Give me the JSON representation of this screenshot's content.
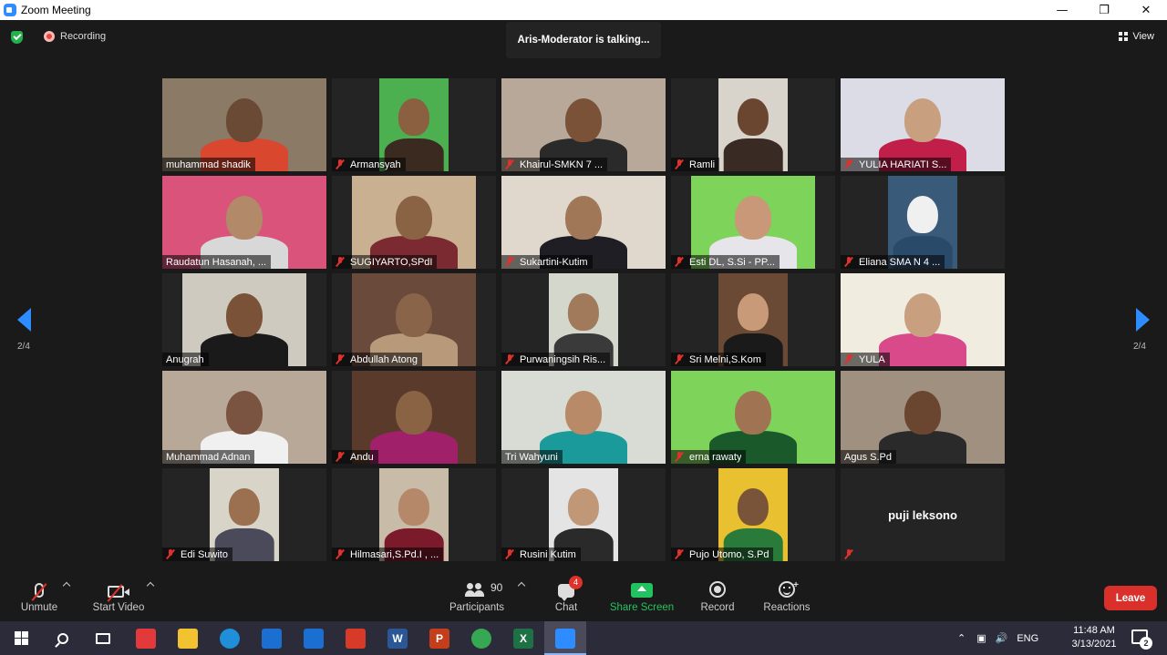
{
  "window": {
    "title": "Zoom Meeting"
  },
  "topbar": {
    "recording_label": "Recording",
    "talking_indicator": "Aris-Moderator is talking...",
    "view_label": "View"
  },
  "navigation": {
    "page_indicator_left": "2/4",
    "page_indicator_right": "2/4"
  },
  "participants": [
    {
      "name": "muhammad shadik",
      "muted": false,
      "video": true,
      "bg": "#8a7a66",
      "face": "#6b4a35",
      "shirt": "#d9472e",
      "vx": 0,
      "vw": 180
    },
    {
      "name": "Armansyah",
      "muted": true,
      "video": true,
      "bg": "#4caf50",
      "face": "#8a6040",
      "shirt": "#3a2a20",
      "vx": 52,
      "vw": 76
    },
    {
      "name": "Khairul-SMKN 7 ...",
      "muted": true,
      "video": true,
      "bg": "#b8a89a",
      "face": "#7a5238",
      "shirt": "#2a2a2a",
      "vx": 0,
      "vw": 180
    },
    {
      "name": "Ramli",
      "muted": true,
      "video": true,
      "bg": "#d8d4cc",
      "face": "#6a4630",
      "shirt": "#3a2a24",
      "vx": 52,
      "vw": 76
    },
    {
      "name": "YULIA HARIATI S...",
      "muted": true,
      "video": true,
      "bg": "#dcdce6",
      "face": "#c8a080",
      "shirt": "#c21e4a",
      "vx": 0,
      "vw": 180
    },
    {
      "name": "Raudatun Hasanah, ...",
      "muted": false,
      "video": true,
      "bg": "#d9537a",
      "face": "#b28a6a",
      "shirt": "#d8d8d8",
      "vx": 0,
      "vw": 180
    },
    {
      "name": "SUGIYARTO,SPdI",
      "muted": true,
      "video": true,
      "bg": "#c8b090",
      "face": "#8a6244",
      "shirt": "#7a2a30",
      "vx": 22,
      "vw": 136
    },
    {
      "name": "Sukartini-Kutim",
      "muted": true,
      "video": true,
      "bg": "#e0d8cc",
      "face": "#a07858",
      "shirt": "#1e1e24",
      "vx": 0,
      "vw": 180
    },
    {
      "name": "Esti DL, S.Si - PP...",
      "muted": true,
      "video": true,
      "bg": "#7ed35a",
      "face": "#c89878",
      "shirt": "#e6e6ea",
      "vx": 22,
      "vw": 136
    },
    {
      "name": "Eliana SMA N 4 ...",
      "muted": true,
      "video": true,
      "bg": "#3a5a7a",
      "face": "#f0f0f0",
      "shirt": "#2a4a6a",
      "vx": 52,
      "vw": 76
    },
    {
      "name": "Anugrah",
      "muted": false,
      "video": true,
      "bg": "#cfcac0",
      "face": "#7a5238",
      "shirt": "#1a1a1a",
      "vx": 22,
      "vw": 136
    },
    {
      "name": "Abdullah Atong",
      "muted": true,
      "video": true,
      "bg": "#6a4a3a",
      "face": "#8a6448",
      "shirt": "#b89a7a",
      "vx": 22,
      "vw": 136
    },
    {
      "name": "Purwaningsih Ris...",
      "muted": true,
      "video": true,
      "bg": "#d4d8cc",
      "face": "#a07a5a",
      "shirt": "#3a3a3a",
      "vx": 52,
      "vw": 76
    },
    {
      "name": "Sri Melni,S.Kom",
      "muted": true,
      "video": true,
      "bg": "#6a4a34",
      "face": "#c89a78",
      "shirt": "#1a1a1a",
      "vx": 52,
      "vw": 76
    },
    {
      "name": "YULA",
      "muted": true,
      "video": true,
      "bg": "#f0ece0",
      "face": "#c8a080",
      "shirt": "#d84a8a",
      "vx": 0,
      "vw": 180
    },
    {
      "name": "Muhammad Adnan",
      "muted": false,
      "video": true,
      "bg": "#b8a898",
      "face": "#7a5440",
      "shirt": "#f0f0f0",
      "vx": 0,
      "vw": 180
    },
    {
      "name": "Andu",
      "muted": true,
      "video": true,
      "bg": "#5a3a2a",
      "face": "#8a6244",
      "shirt": "#a0206a",
      "vx": 22,
      "vw": 136
    },
    {
      "name": "Tri Wahyuni",
      "muted": false,
      "video": true,
      "bg": "#d8dcd4",
      "face": "#b88a68",
      "shirt": "#1a9a9a",
      "vx": 0,
      "vw": 180
    },
    {
      "name": "erna rawaty",
      "muted": true,
      "video": true,
      "bg": "#7ed35a",
      "face": "#a07452",
      "shirt": "#1a5a2a",
      "vx": 0,
      "vw": 180
    },
    {
      "name": "Agus S.Pd",
      "muted": false,
      "video": true,
      "bg": "#a09080",
      "face": "#6a4630",
      "shirt": "#2a2a2a",
      "vx": 0,
      "vw": 180
    },
    {
      "name": "Edi Suwito",
      "muted": true,
      "video": true,
      "bg": "#d8d4c8",
      "face": "#9a7050",
      "shirt": "#4a4a5a",
      "vx": 52,
      "vw": 76
    },
    {
      "name": "Hilmasari,S.Pd.I , ...",
      "muted": true,
      "video": true,
      "bg": "#c8bca8",
      "face": "#b48868",
      "shirt": "#7a1a2a",
      "vx": 52,
      "vw": 76
    },
    {
      "name": "Rusini Kutim",
      "muted": true,
      "video": true,
      "bg": "#e4e4e4",
      "face": "#c09878",
      "shirt": "#2a2a2a",
      "vx": 52,
      "vw": 76
    },
    {
      "name": "Pujo Utomo, S.Pd",
      "muted": true,
      "video": true,
      "bg": "#e8c030",
      "face": "#7a5438",
      "shirt": "#2a7a3a",
      "vx": 52,
      "vw": 76
    },
    {
      "name": "puji leksono",
      "muted": true,
      "video": false,
      "bg": "#242424",
      "face": "",
      "shirt": "",
      "vx": 0,
      "vw": 0
    }
  ],
  "toolbar": {
    "unmute": "Unmute",
    "start_video": "Start Video",
    "participants": "Participants",
    "participant_count": "90",
    "chat": "Chat",
    "chat_badge": "4",
    "share_screen": "Share Screen",
    "record": "Record",
    "reactions": "Reactions",
    "leave": "Leave"
  },
  "taskbar": {
    "language": "ENG",
    "time": "11:48 AM",
    "date": "3/13/2021",
    "notification_count": "2",
    "apps": [
      {
        "icon": "gift-icon",
        "color": "#e23a3a",
        "glyph": ""
      },
      {
        "icon": "file-explorer-icon",
        "color": "#f2c230",
        "glyph": ""
      },
      {
        "icon": "edge-icon",
        "color": "#1e8fd8",
        "glyph": ""
      },
      {
        "icon": "store-icon",
        "color": "#1a6fd0",
        "glyph": ""
      },
      {
        "icon": "mail-icon",
        "color": "#1a6fd0",
        "glyph": ""
      },
      {
        "icon": "media-player-icon",
        "color": "#d83a2a",
        "glyph": ""
      },
      {
        "icon": "word-icon",
        "color": "#2b5797",
        "glyph": "W"
      },
      {
        "icon": "powerpoint-icon",
        "color": "#c43e1c",
        "glyph": "P"
      },
      {
        "icon": "chrome-icon",
        "color": "#34a853",
        "glyph": ""
      },
      {
        "icon": "excel-icon",
        "color": "#1e7145",
        "glyph": "X"
      },
      {
        "icon": "zoom-icon",
        "color": "#2d8cff",
        "glyph": ""
      }
    ]
  }
}
